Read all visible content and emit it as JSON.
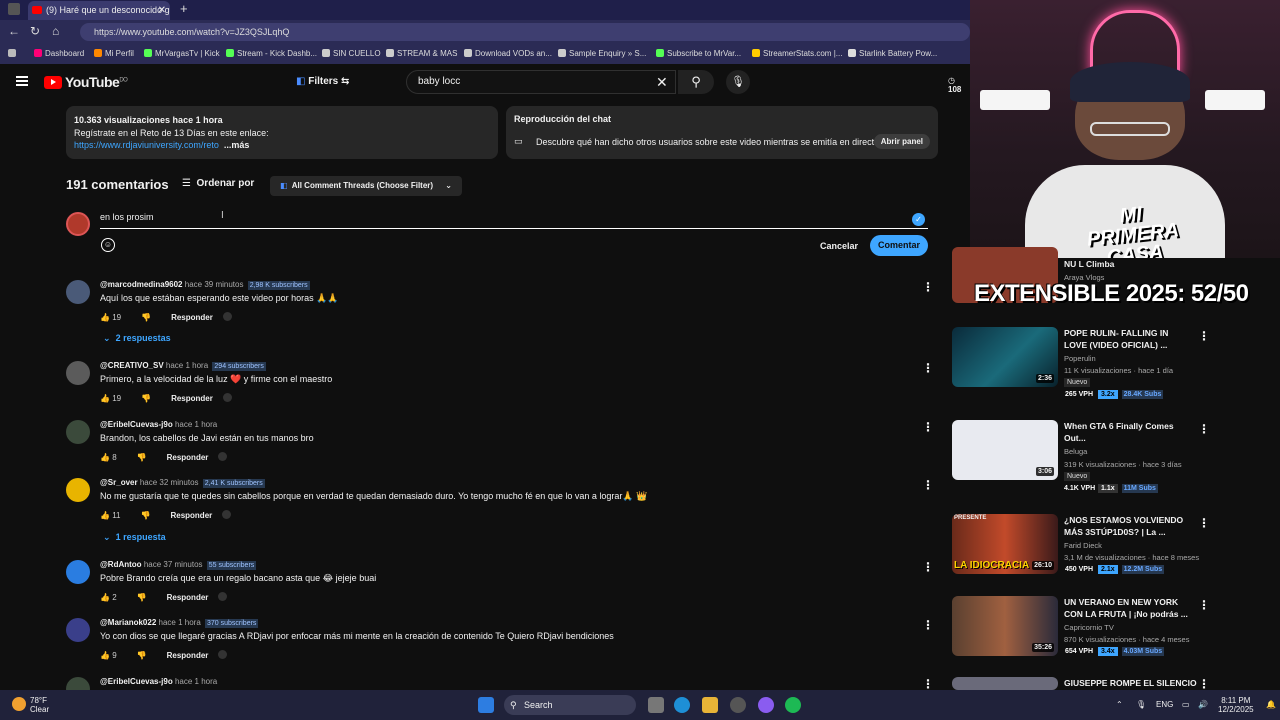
{
  "browser": {
    "tab_title": "(9) Haré que un desconocido gan",
    "url": "https://www.youtube.com/watch?v=JZ3QSJLqhQ",
    "bookmarks": [
      "Dashboard",
      "Mi Perfil",
      "MrVargasTv | Kick",
      "Stream - Kick Dashb...",
      "SIN CUELLO",
      "STREAM & MAS",
      "Download VODs an...",
      "Sample Enquiry » S...",
      "Subscribe to MrVar...",
      "StreamerStats.com |...",
      "Starlink Battery Pow..."
    ]
  },
  "youtube": {
    "logo": "YouTube",
    "country": "DO",
    "filters": "Filters",
    "search_value": "baby locc",
    "counter_partial": "108"
  },
  "description": {
    "stats": "10.363 visualizaciones  hace 1 hora",
    "line2": "Regístrate en el Reto de 13 Días en este enlace:",
    "link": "https://www.rdjaviuniversity.com/reto",
    "more": "...más"
  },
  "chat_replay": {
    "title": "Reproducción del chat",
    "text": "Descubre qué han dicho otros usuarios sobre este video mientras se emitía en directo.",
    "button": "Abrir panel"
  },
  "comments_header": {
    "count": "191 comentarios",
    "sort": "Ordenar por",
    "threads": "All Comment Threads (Choose Filter)"
  },
  "comment_box": {
    "value": "en los prosim",
    "cancel": "Cancelar",
    "submit": "Comentar"
  },
  "comments": [
    {
      "author": "@marcodmedina9602",
      "time": "hace 39 minutos",
      "subs": "2,98 K subscribers",
      "text": "Aquí los que estában esperando este video por horas 🙏🙏",
      "likes": "19",
      "reply": "Responder",
      "replies": "2 respuestas"
    },
    {
      "author": "@CREATIVO_SV",
      "time": "hace 1 hora",
      "subs": "294 subscribers",
      "text": "Primero, a la velocidad de la luz ❤️ y firme con el maestro",
      "likes": "19",
      "reply": "Responder",
      "replies": ""
    },
    {
      "author": "@EribelCuevas-j9o",
      "time": "hace 1 hora",
      "subs": "",
      "text": "Brandon, los cabellos de Javi están en tus manos bro",
      "likes": "8",
      "reply": "Responder",
      "replies": ""
    },
    {
      "author": "@Sr_over",
      "time": "hace 32 minutos",
      "subs": "2,41 K subscribers",
      "text": "No me gustaría que te quedes sin cabellos porque en verdad te quedan demasiado duro. Yo tengo mucho fé en que lo van a lograr🙏 👑",
      "likes": "11",
      "reply": "Responder",
      "replies": "1 respuesta"
    },
    {
      "author": "@RdAntoo",
      "time": "hace 37 minutos",
      "subs": "55 subscribers",
      "text": "Pobre Brando creía que era un regalo bacano asta que 😂 jejeje buai",
      "likes": "2",
      "reply": "Responder",
      "replies": ""
    },
    {
      "author": "@Marianok022",
      "time": "hace 1 hora",
      "subs": "370 subscribers",
      "text": "Yo con dios se que llegaré gracias A RDjavi por enfocar más mi mente en la creación de contenido Te Quiero RDjavi bendiciones",
      "likes": "9",
      "reply": "Responder",
      "replies": ""
    },
    {
      "author": "@EribelCuevas-j9o",
      "time": "hace 1 hora",
      "subs": "",
      "text": "",
      "likes": "",
      "reply": "",
      "replies": ""
    }
  ],
  "overlay": {
    "neon_text": "MI PRIMERA CASA",
    "banner": "EXTENSIBLE 2025: 52/50",
    "partial_title": "NU          L  Climba",
    "partial_channel": "Araya Vlogs"
  },
  "recommendations": [
    {
      "title": "POPE RULIN- FALLING IN LOVE (VIDEO OFICIAL) ...",
      "channel": "Poperulin",
      "meta": "11 K visualizaciones · hace 1 día",
      "badge": "Nuevo",
      "duration": "2:36",
      "vph": "265 VPH",
      "mult": "3.2x",
      "subs": "28.4K Subs"
    },
    {
      "title": "When GTA 6 Finally Comes Out...",
      "channel": "Beluga",
      "meta": "319 K visualizaciones · hace 3 días",
      "badge": "Nuevo",
      "duration": "3:06",
      "vph": "4.1K VPH",
      "mult": "1.1x",
      "subs": "11M Subs"
    },
    {
      "title": "¿NOS ESTAMOS VOLVIENDO MÁS 3STÚP1D0S? | La ...",
      "channel": "Farid Dieck",
      "meta": "3,1 M de visualizaciones · hace 8 meses",
      "badge": "",
      "duration": "26:10",
      "thumb_text": "LA IDIOCRACIA",
      "thumb_top": "PRESENTE",
      "vph": "450 VPH",
      "mult": "2.1x",
      "subs": "12.2M Subs"
    },
    {
      "title": "UN VERANO EN NEW YORK CON LA FRUTA | ¡No podrás ...",
      "channel": "Capricornio TV",
      "meta": "870 K visualizaciones · hace 4 meses",
      "badge": "",
      "duration": "35:26",
      "vph": "654 VPH",
      "mult": "3.4x",
      "subs": "4.03M Subs"
    },
    {
      "title": "GIUSEPPE ROMPE EL SILENCIO",
      "channel": "",
      "meta": "",
      "badge": "",
      "duration": "",
      "vph": "",
      "mult": "",
      "subs": ""
    }
  ],
  "taskbar": {
    "temp": "78°F",
    "condition": "Clear",
    "search": "Search",
    "lang": "ENG",
    "time": "8:11 PM",
    "date": "12/2/2025"
  }
}
